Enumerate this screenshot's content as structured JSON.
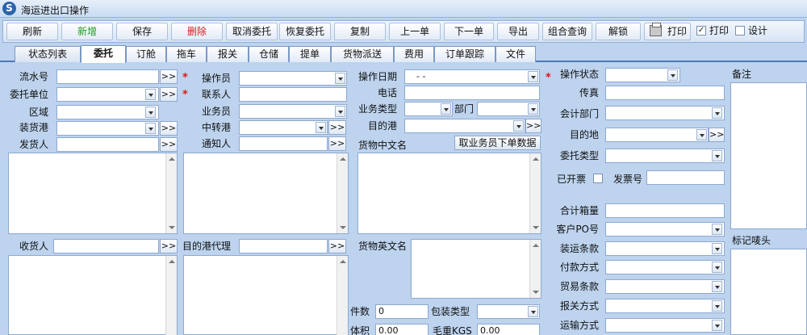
{
  "window": {
    "title": "海运进出口操作"
  },
  "toolbar": {
    "refresh": "刷新",
    "new": "新增",
    "save": "保存",
    "delete": "删除",
    "cancel_entrust": "取消委托",
    "restore_entrust": "恢复委托",
    "copy": "复制",
    "prev": "上一单",
    "next": "下一单",
    "export": "导出",
    "combo_query": "组合查询",
    "unlock": "解锁",
    "print": "打印",
    "print_check": "打印",
    "design": "设计",
    "print_checked": "✓"
  },
  "tabs": [
    "状态列表",
    "委托",
    "订舱",
    "拖车",
    "报关",
    "仓储",
    "提单",
    "货物派送",
    "费用",
    "订单跟踪",
    "文件"
  ],
  "colors": {
    "accent": "#2e63a8",
    "required": "#d21b1b",
    "new_button": "#1f9a1f"
  },
  "form": {
    "serial_no": "流水号",
    "client_unit": "委托单位",
    "area": "区域",
    "port_of_loading": "装货港",
    "shipper": "发货人",
    "consignee": "收货人",
    "operator": "操作员",
    "contact": "联系人",
    "salesman": "业务员",
    "transit_port": "中转港",
    "notify": "通知人",
    "dest_agent": "目的港代理",
    "op_date": "操作日期",
    "op_date_value": "-   -",
    "phone": "电话",
    "biz_type": "业务类型",
    "department": "部门",
    "dest_port": "目的港",
    "cargo_cn": "货物中文名",
    "fetch_sales_btn": "取业务员下单数据",
    "cargo_en": "货物英文名",
    "pieces": "件数",
    "pieces_value": "0",
    "package_type": "包装类型",
    "volume": "体积",
    "volume_value": "0.00",
    "gross_weight": "毛重KGS",
    "gross_weight_value": "0.00",
    "op_status": "操作状态",
    "fax": "传真",
    "acct_dept": "会计部门",
    "destination": "目的地",
    "entrust_type": "委托类型",
    "invoiced": "已开票",
    "invoice_no": "发票号",
    "total_boxes": "合计箱量",
    "customer_po": "客户PO号",
    "loading_terms": "装运条款",
    "payment_method": "付款方式",
    "trade_terms": "贸易条款",
    "customs_method": "报关方式",
    "transport_method": "运输方式",
    "remarks": "备注",
    "marks": "标记唛头",
    "ptr_glyph": ">>"
  }
}
